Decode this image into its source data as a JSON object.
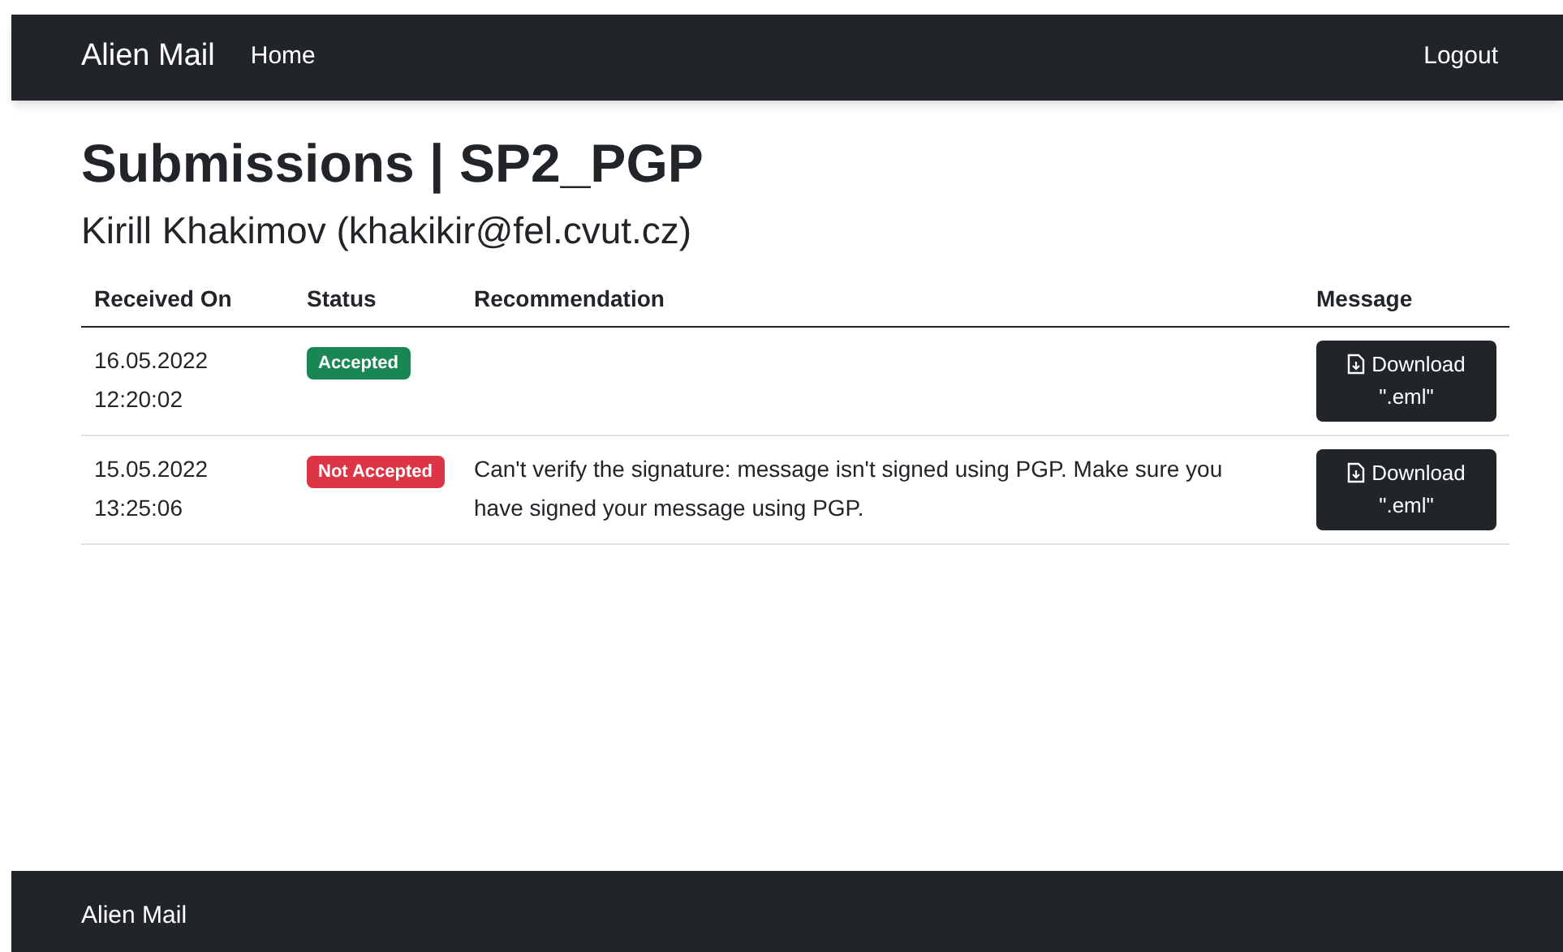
{
  "navbar": {
    "brand": "Alien Mail",
    "links": [
      "Home"
    ],
    "logout": "Logout"
  },
  "page": {
    "title": "Submissions | SP2_PGP",
    "subtitle": "Kirill Khakimov (khakikir@fel.cvut.cz)"
  },
  "table": {
    "columns": [
      "Received On",
      "Status",
      "Recommendation",
      "Message"
    ],
    "rows": [
      {
        "date": "16.05.2022",
        "time": "12:20:02",
        "status": {
          "label": "Accepted",
          "kind": "accepted"
        },
        "button": {
          "line_1": "Download",
          "line_2": "\".eml\""
        }
      },
      {
        "date": "15.05.2022",
        "time": "13:25:06",
        "status": {
          "label": "Not Accepted",
          "kind": "rejected"
        },
        "recommendation": "Can't verify the signature: message isn't signed using PGP. Make sure you have signed your message using PGP.",
        "button": {
          "line_1": "Download",
          "line_2": "\".eml\""
        }
      }
    ]
  },
  "footer": {
    "brand": "Alien Mail"
  }
}
